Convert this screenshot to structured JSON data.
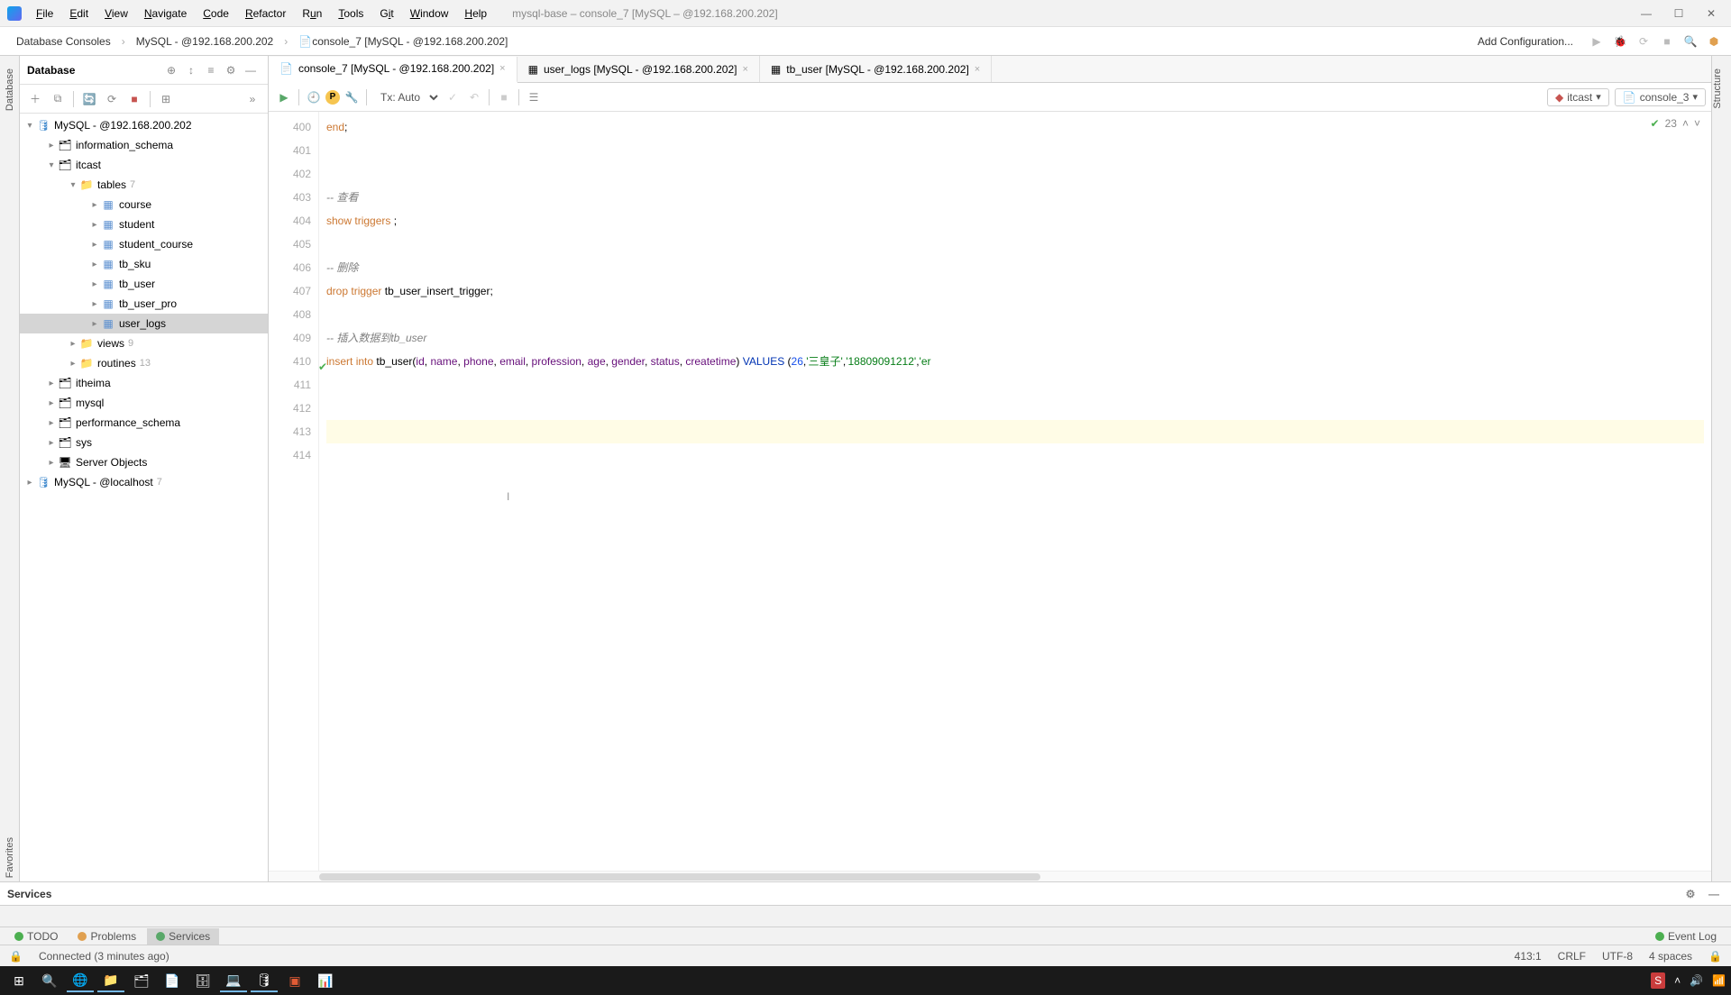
{
  "window": {
    "title": "mysql-base – console_7 [MySQL – @192.168.200.202]"
  },
  "menu": [
    "File",
    "Edit",
    "View",
    "Navigate",
    "Code",
    "Refactor",
    "Run",
    "Tools",
    "Git",
    "Window",
    "Help"
  ],
  "breadcrumbs": {
    "c0": "Database Consoles",
    "c1": "MySQL - @192.168.200.202",
    "c2": "console_7 [MySQL - @192.168.200.202]"
  },
  "toolbar_right": {
    "add_config": "Add Configuration..."
  },
  "sidebar": {
    "title": "Database",
    "root0": {
      "label": "MySQL - @192.168.200.202"
    },
    "schemas": {
      "information_schema": "information_schema",
      "itcast": "itcast",
      "tables_label": "tables",
      "tables_count": "7",
      "tables": {
        "course": "course",
        "student": "student",
        "student_course": "student_course",
        "tb_sku": "tb_sku",
        "tb_user": "tb_user",
        "tb_user_pro": "tb_user_pro",
        "user_logs": "user_logs"
      },
      "views_label": "views",
      "views_count": "9",
      "routines_label": "routines",
      "routines_count": "13",
      "itheima": "itheima",
      "mysql": "mysql",
      "performance_schema": "performance_schema",
      "sys": "sys",
      "server_objects": "Server Objects"
    },
    "root1": {
      "label": "MySQL - @localhost",
      "count": "7"
    }
  },
  "tabs": {
    "t0": "console_7 [MySQL - @192.168.200.202]",
    "t1": "user_logs [MySQL - @192.168.200.202]",
    "t2": "tb_user [MySQL - @192.168.200.202]"
  },
  "editor_toolbar": {
    "tx_mode": "Tx: Auto",
    "chip_db": "itcast",
    "chip_console": "console_3"
  },
  "gutter": {
    "l400": "400",
    "l401": "401",
    "l402": "402",
    "l403": "403",
    "l404": "404",
    "l405": "405",
    "l406": "406",
    "l407": "407",
    "l408": "408",
    "l409": "409",
    "l410": "410",
    "l411": "411",
    "l412": "412",
    "l413": "413",
    "l414": "414"
  },
  "code": {
    "l400_end": "end",
    "l400_semi": ";",
    "l403_c": "-- 查看",
    "l404_a": "show",
    "l404_b": "triggers",
    "l404_c": " ;",
    "l406_c": "-- 删除",
    "l407_a": "drop",
    "l407_b": "trigger",
    "l407_c": "tb_user_insert_trigger;",
    "l409_c": "-- 插入数据到tb_user",
    "l410_ins": "insert",
    "l410_into": "into",
    "l410_tbl": "tb_user",
    "l410_cols": {
      "id": "id",
      "name": "name",
      "phone": "phone",
      "email": "email",
      "profession": "profession",
      "age": "age",
      "gender": "gender",
      "status": "status",
      "createtime": "createtime"
    },
    "l410_values_kw": "VALUES",
    "l410_v_id": "26",
    "l410_v_name": "'三皇子'",
    "l410_v_phone": "'18809091212'",
    "l410_v_tail": "'er"
  },
  "inspect": {
    "count": "23"
  },
  "services": {
    "title": "Services"
  },
  "bottom_tabs": {
    "todo": "TODO",
    "problems": "Problems",
    "services": "Services",
    "event_log": "Event Log"
  },
  "status": {
    "msg": "Connected (3 minutes ago)",
    "pos": "413:1",
    "eol": "CRLF",
    "enc": "UTF-8",
    "indent": "4 spaces"
  },
  "left_tabs": {
    "database": "Database",
    "favorites": "Favorites"
  },
  "right_tabs": {
    "structure": "Structure"
  }
}
